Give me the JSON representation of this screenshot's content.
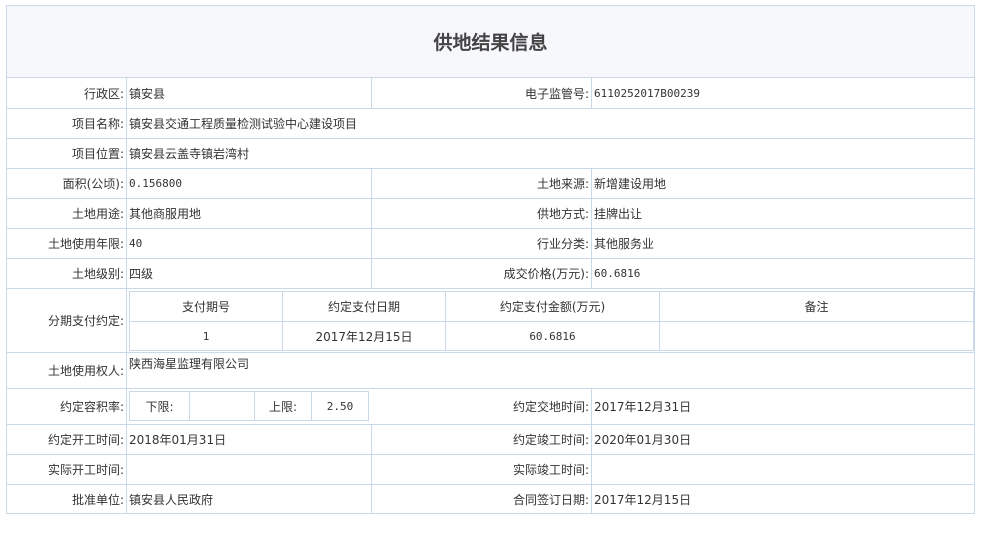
{
  "title": "供地结果信息",
  "rows": {
    "region": {
      "label": "行政区:",
      "value": "镇安县"
    },
    "supervision_no": {
      "label": "电子监管号:",
      "value": "6110252017B00239"
    },
    "project_name": {
      "label": "项目名称:",
      "value": "镇安县交通工程质量检测试验中心建设项目"
    },
    "project_location": {
      "label": "项目位置:",
      "value": "镇安县云盖寺镇岩湾村"
    },
    "area": {
      "label": "面积(公顷):",
      "value": "0.156800"
    },
    "land_source": {
      "label": "土地来源:",
      "value": "新增建设用地"
    },
    "land_use": {
      "label": "土地用途:",
      "value": "其他商服用地"
    },
    "supply_method": {
      "label": "供地方式:",
      "value": "挂牌出让"
    },
    "use_years": {
      "label": "土地使用年限:",
      "value": "40"
    },
    "industry": {
      "label": "行业分类:",
      "value": "其他服务业"
    },
    "land_grade": {
      "label": "土地级别:",
      "value": "四级"
    },
    "deal_price": {
      "label": "成交价格(万元):",
      "value": "60.6816"
    },
    "installments_label": "分期支付约定:",
    "land_user": {
      "label": "土地使用权人:",
      "value": "陕西海星监理有限公司"
    },
    "far": {
      "label": "约定容积率:",
      "lower_label": "下限:",
      "lower_value": "",
      "upper_label": "上限:",
      "upper_value": "2.50"
    },
    "handover_time": {
      "label": "约定交地时间:",
      "value": "2017年12月31日"
    },
    "start_time": {
      "label": "约定开工时间:",
      "value": "2018年01月31日"
    },
    "finish_time": {
      "label": "约定竣工时间:",
      "value": "2020年01月30日"
    },
    "actual_start": {
      "label": "实际开工时间:",
      "value": ""
    },
    "actual_finish": {
      "label": "实际竣工时间:",
      "value": ""
    },
    "approval_unit": {
      "label": "批准单位:",
      "value": "镇安县人民政府"
    },
    "contract_date": {
      "label": "合同签订日期:",
      "value": "2017年12月15日"
    }
  },
  "installments": {
    "headers": [
      "支付期号",
      "约定支付日期",
      "约定支付金额(万元)",
      "备注"
    ],
    "rows": [
      [
        "1",
        "2017年12月15日",
        "60.6816",
        ""
      ]
    ]
  }
}
